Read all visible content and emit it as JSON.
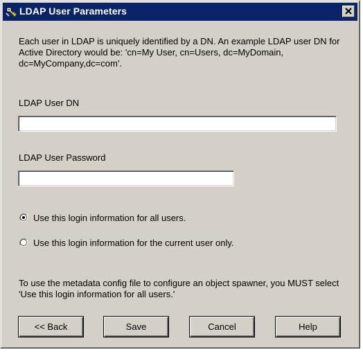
{
  "window": {
    "title": "LDAP User Parameters",
    "title_icon": "ldap-key-icon",
    "close_icon": "close-icon",
    "colors": {
      "titlebar": "#0a246a",
      "face": "#d4d0c8"
    }
  },
  "description": "Each user in LDAP is uniquely identified by a DN.  An example LDAP user DN for Active Directory would be: 'cn=My User, cn=Users, dc=MyDomain, dc=MyCompany,dc=com'.",
  "fields": {
    "user_dn": {
      "label": "LDAP User DN",
      "value": ""
    },
    "password": {
      "label": "LDAP User Password",
      "value": ""
    }
  },
  "options": [
    {
      "label": "Use this login information for all users.",
      "selected": true
    },
    {
      "label": "Use this login information for the current user only.",
      "selected": false
    }
  ],
  "note": "To use the metadata config file to configure an object spawner, you MUST select 'Use this login information for all users.'",
  "buttons": {
    "back": "<< Back",
    "save": "Save",
    "cancel": "Cancel",
    "help": "Help"
  }
}
